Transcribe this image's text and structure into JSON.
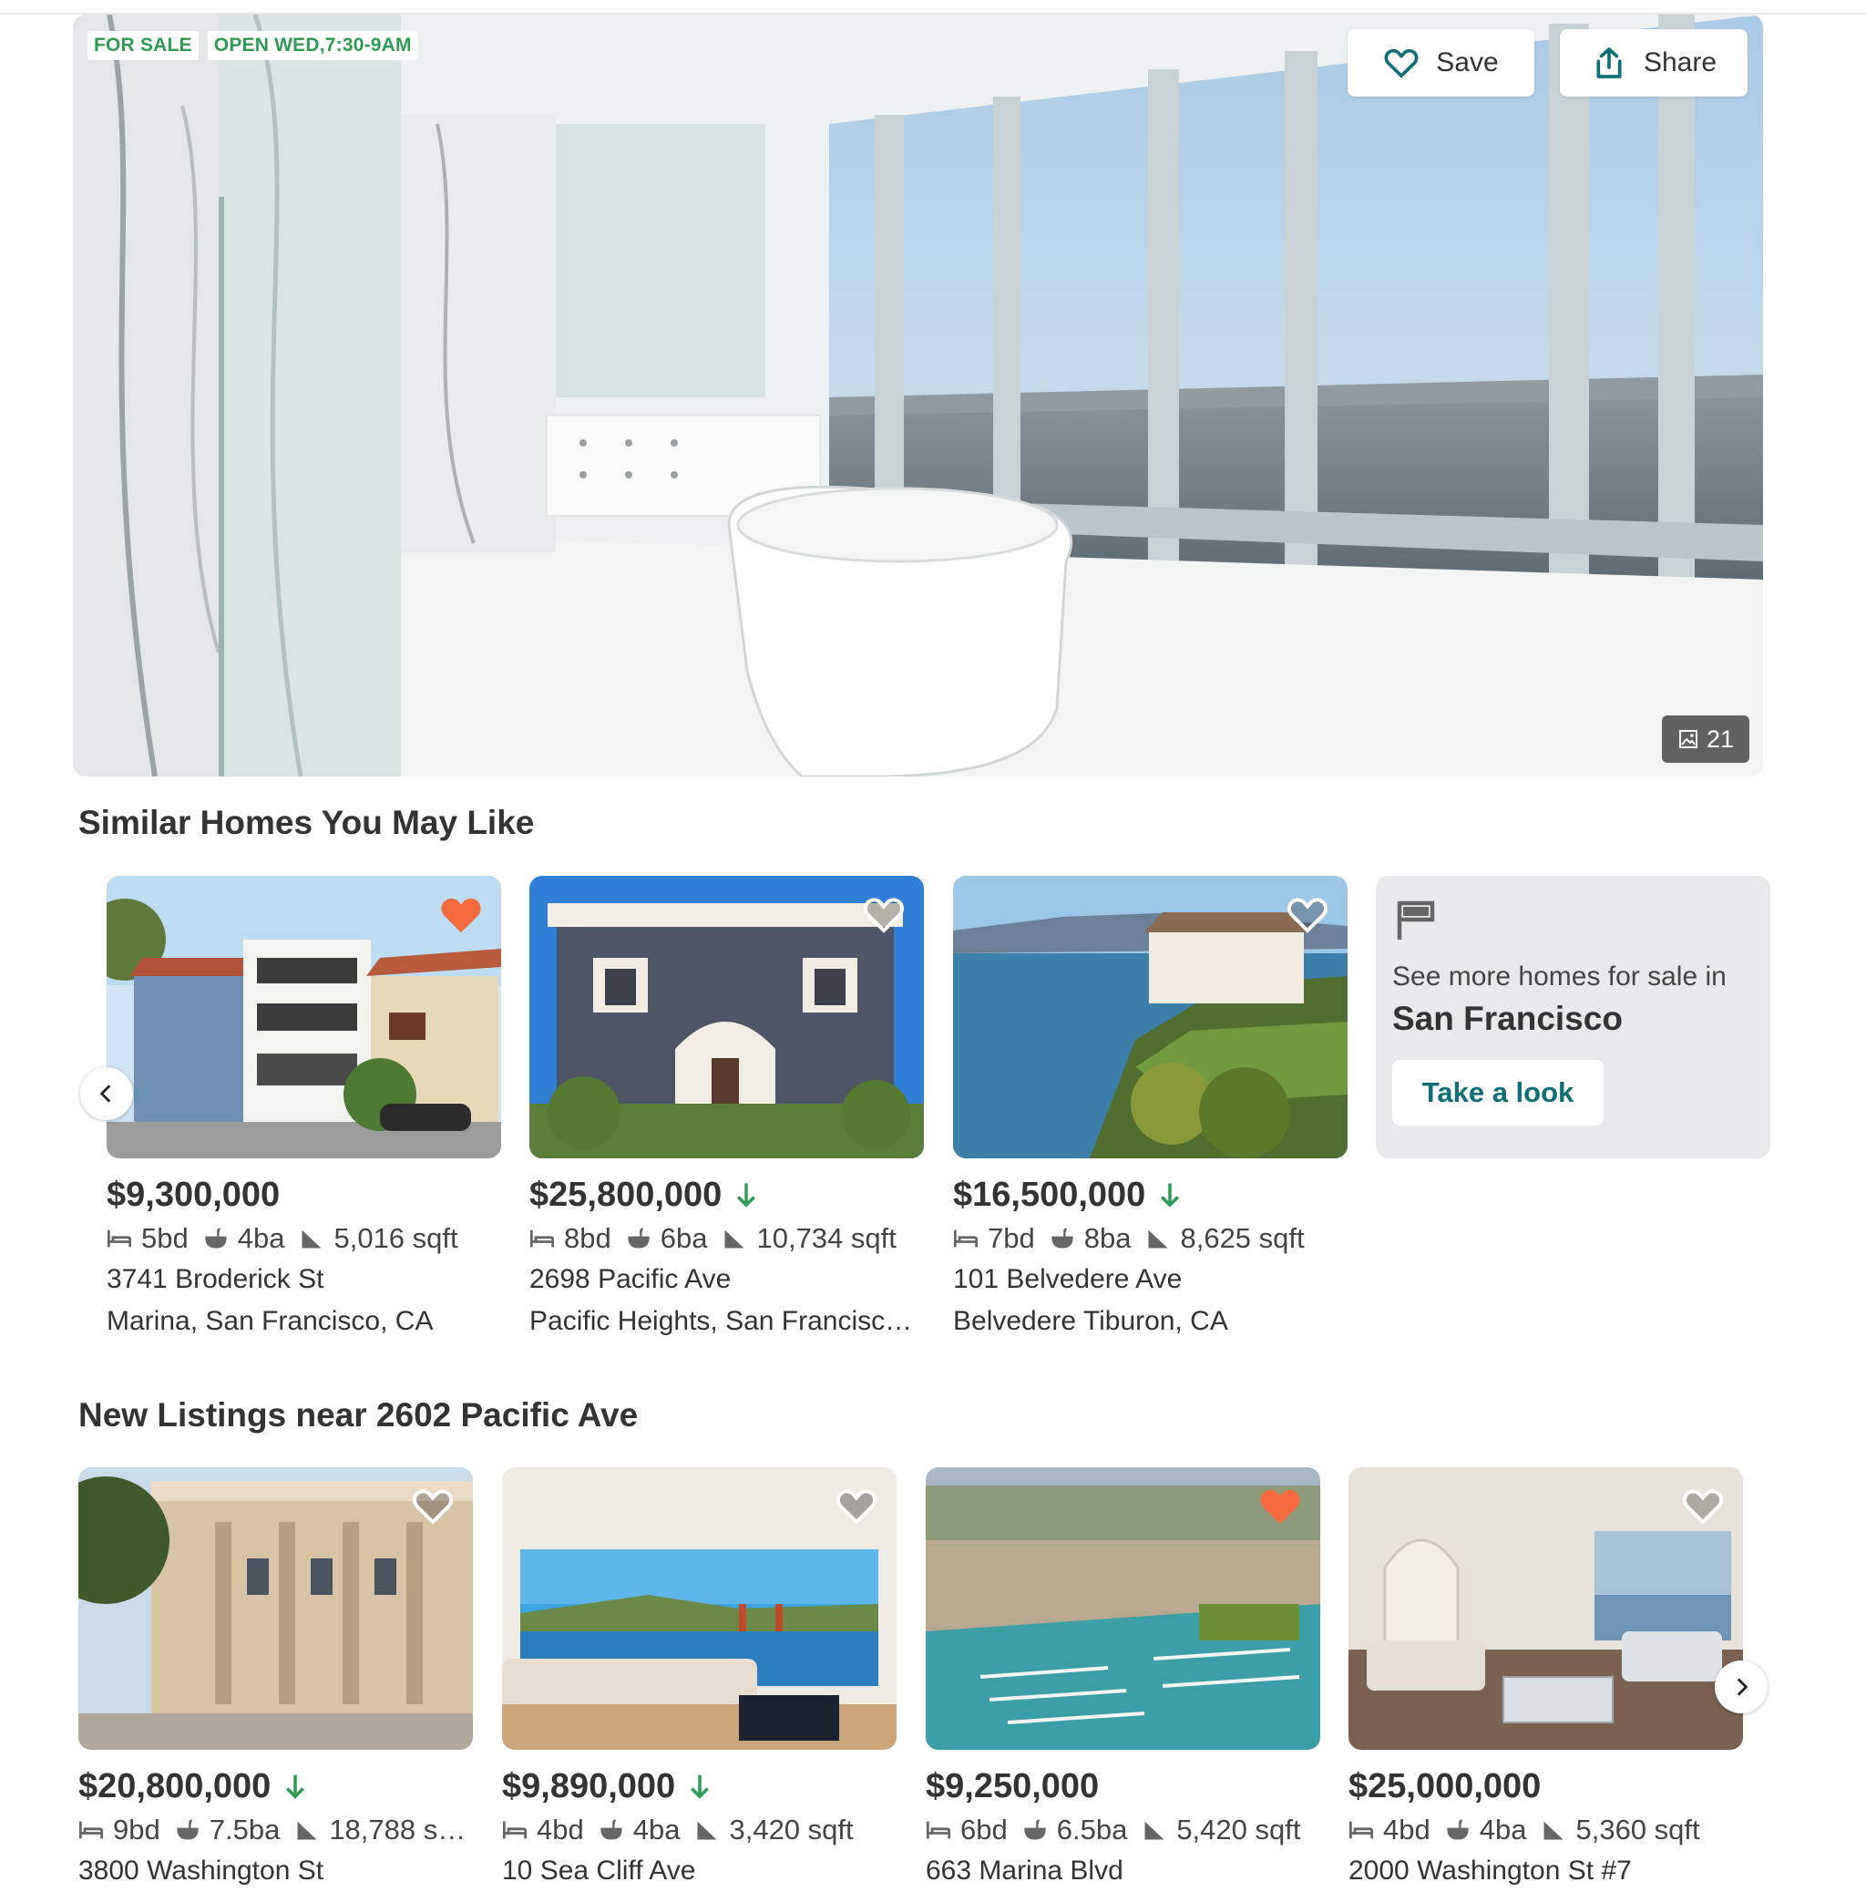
{
  "hero": {
    "badges": [
      "FOR SALE",
      "OPEN WED,7:30-9AM"
    ],
    "save_label": "Save",
    "share_label": "Share",
    "photo_count": "21"
  },
  "similar": {
    "title": "Similar Homes You May Like",
    "cards": [
      {
        "price": "$9,300,000",
        "price_drop": false,
        "beds": "5bd",
        "baths": "4ba",
        "sqft": "5,016 sqft",
        "street": "3741 Broderick St",
        "city": "Marina, San Francisco, CA",
        "favorited": true
      },
      {
        "price": "$25,800,000",
        "price_drop": true,
        "beds": "8bd",
        "baths": "6ba",
        "sqft": "10,734 sqft",
        "street": "2698 Pacific Ave",
        "city": "Pacific Heights, San Francisc…",
        "favorited": false
      },
      {
        "price": "$16,500,000",
        "price_drop": true,
        "beds": "7bd",
        "baths": "8ba",
        "sqft": "8,625 sqft",
        "street": "101 Belvedere Ave",
        "city": "Belvedere Tiburon, CA",
        "favorited": false
      }
    ],
    "see_more": {
      "line1": "See more homes for sale in",
      "line2": "San Francisco",
      "button": "Take a look"
    }
  },
  "new_listings": {
    "title": "New Listings near 2602 Pacific Ave",
    "cards": [
      {
        "price": "$20,800,000",
        "price_drop": true,
        "beds": "9bd",
        "baths": "7.5ba",
        "sqft": "18,788 s…",
        "street": "3800 Washington St",
        "favorited": false
      },
      {
        "price": "$9,890,000",
        "price_drop": true,
        "beds": "4bd",
        "baths": "4ba",
        "sqft": "3,420 sqft",
        "street": "10 Sea Cliff Ave",
        "favorited": false
      },
      {
        "price": "$9,250,000",
        "price_drop": false,
        "beds": "6bd",
        "baths": "6.5ba",
        "sqft": "5,420 sqft",
        "street": "663 Marina Blvd",
        "favorited": true
      },
      {
        "price": "$25,000,000",
        "price_drop": false,
        "beds": "4bd",
        "baths": "4ba",
        "sqft": "5,360 sqft",
        "street": "2000 Washington St #7",
        "favorited": false
      }
    ]
  },
  "colors": {
    "favorite": "#f26a3d",
    "price_drop": "#2e9b55",
    "brand_teal": "#0d6e76"
  },
  "icons": [
    "heart-icon",
    "share-icon",
    "gallery-icon",
    "bed-icon",
    "bath-icon",
    "sqft-icon",
    "flag-icon",
    "chevron-left-icon",
    "chevron-right-icon",
    "arrow-down-icon"
  ]
}
